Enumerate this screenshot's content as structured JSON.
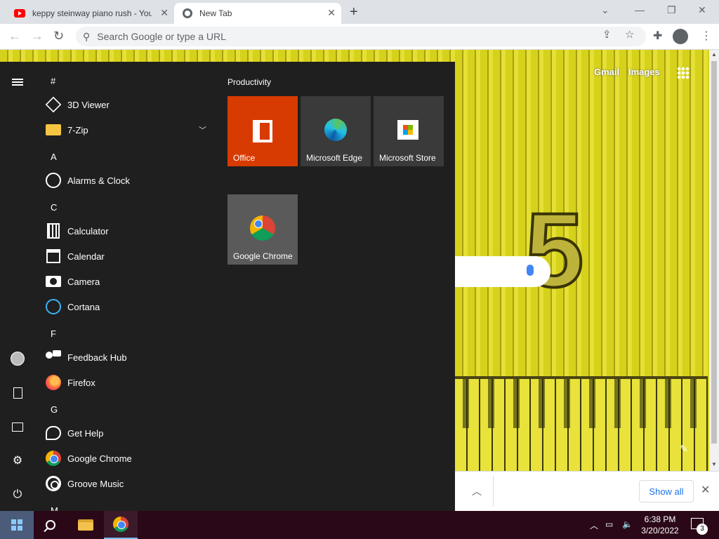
{
  "browser": {
    "tabs": [
      {
        "title": "keppy steinway piano rush - YouTube",
        "icon": "youtube-icon"
      },
      {
        "title": "New Tab",
        "icon": "chrome-icon"
      }
    ],
    "omnibox_placeholder": "Search Google or type a URL"
  },
  "newtab": {
    "gmail": "Gmail",
    "images": "Images"
  },
  "downloadbar": {
    "show_all": "Show all"
  },
  "startmenu": {
    "letters": [
      "#",
      "A",
      "C",
      "F",
      "G",
      "M"
    ],
    "apps": {
      "viewer3d": "3D Viewer",
      "zip": "7-Zip",
      "alarms": "Alarms & Clock",
      "calculator": "Calculator",
      "calendar": "Calendar",
      "camera": "Camera",
      "cortana": "Cortana",
      "feedback": "Feedback Hub",
      "firefox": "Firefox",
      "gethelp": "Get Help",
      "chrome": "Google Chrome",
      "groove": "Groove Music"
    },
    "group_title": "Productivity",
    "tiles": {
      "office": "Office",
      "edge": "Microsoft Edge",
      "store": "Microsoft Store",
      "chrome": "Google Chrome"
    }
  },
  "taskbar": {
    "time": "6:38 PM",
    "date": "3/20/2022",
    "notification_count": "3"
  },
  "colors": {
    "office_tile": "#d83b01",
    "tile_dark": "#3a3a3a",
    "tile_chrome": "#5a5a5a",
    "taskbar": "#2b0818",
    "startmenu": "#1f1f1f"
  }
}
